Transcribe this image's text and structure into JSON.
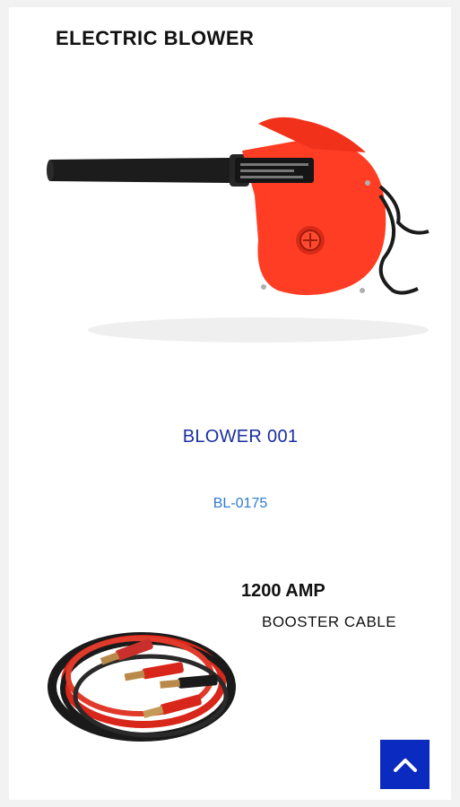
{
  "banner": {
    "title": "ELECTRIC BLOWER"
  },
  "product": {
    "name": "BLOWER 001",
    "code": "BL-0175"
  },
  "next_banner": {
    "title": "1200 AMP",
    "subtitle": "BOOSTER CABLE"
  },
  "scroll_top": {
    "icon": "chevron-up-icon"
  },
  "colors": {
    "brand_blue": "#0b2ac0",
    "product_name": "#1a2fa0",
    "product_code": "#2f7bd0",
    "blower_red": "#ff3d24"
  }
}
